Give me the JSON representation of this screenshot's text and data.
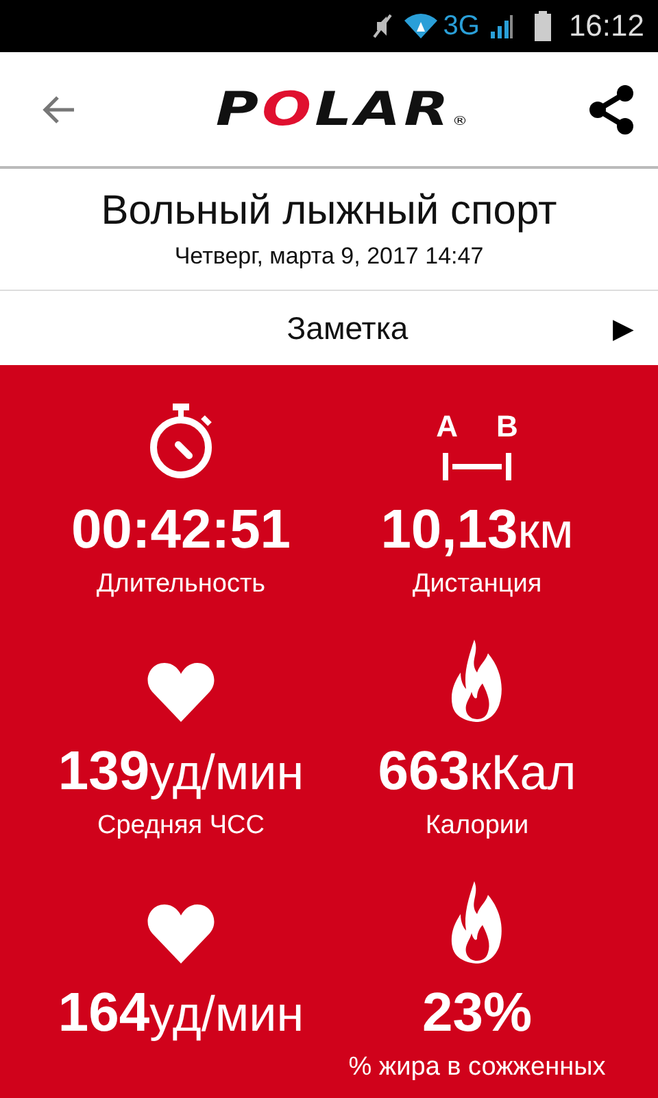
{
  "status_bar": {
    "network": "3G",
    "time": "16:12"
  },
  "header": {
    "logo": "POLAR",
    "logo_mark": "®"
  },
  "activity": {
    "title": "Вольный лыжный спорт",
    "date": "Четверг, марта 9, 2017 14:47"
  },
  "note": {
    "label": "Заметка",
    "arrow": "▶"
  },
  "distance_icon": {
    "marks": [
      "A",
      "B"
    ]
  },
  "stats": [
    {
      "kind": "stopwatch",
      "value": "00:42:51",
      "label": "Длительность"
    },
    {
      "kind": "distance",
      "value": "10,13",
      "unit": "км",
      "label": "Дистанция"
    },
    {
      "kind": "heart",
      "value": "139",
      "unit": "уд/мин",
      "label": "Средняя ЧСС"
    },
    {
      "kind": "flame",
      "value": "663",
      "unit": "кКал",
      "label": "Калории"
    },
    {
      "kind": "heart",
      "value": "164",
      "unit": "уд/мин"
    },
    {
      "kind": "flame",
      "value": "23%",
      "label": "% жира в сожженных"
    }
  ]
}
